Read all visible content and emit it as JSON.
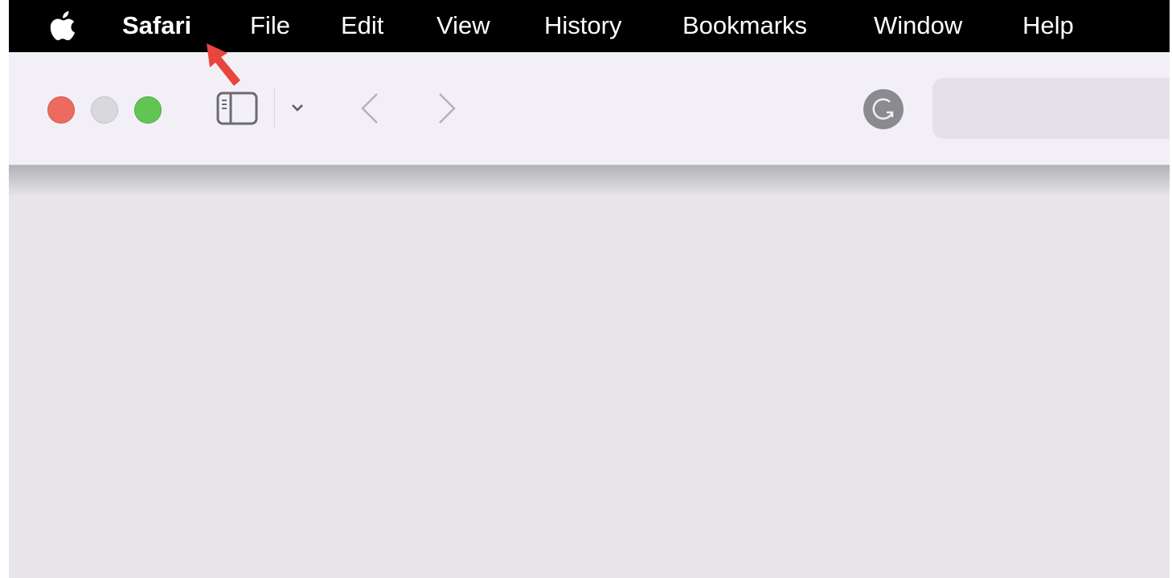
{
  "menubar": {
    "app_name": "Safari",
    "items": [
      "File",
      "Edit",
      "View",
      "History",
      "Bookmarks",
      "Window",
      "Help"
    ]
  },
  "toolbar": {
    "traffic_lights": {
      "close_color": "#ec6a5e",
      "minimize_color": "#d9d8dc",
      "zoom_color": "#61c554"
    },
    "address_bar_value": ""
  },
  "annotation": {
    "arrow_color": "#e8453c",
    "points_to": "Safari"
  }
}
